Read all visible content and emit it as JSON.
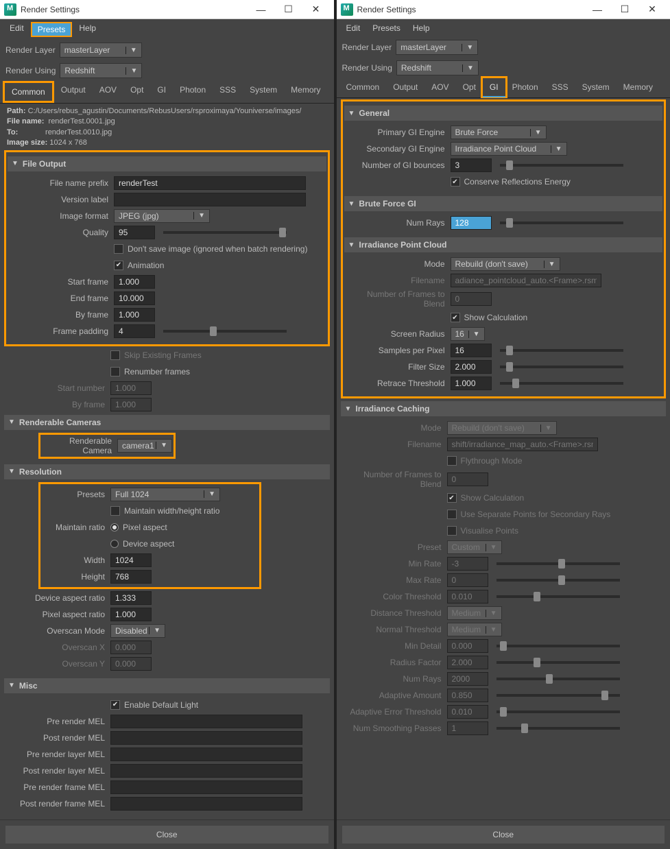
{
  "shared": {
    "window_title": "Render Settings",
    "menu": {
      "edit": "Edit",
      "presets": "Presets",
      "help": "Help"
    },
    "render_layer_lbl": "Render Layer",
    "render_layer_val": "masterLayer",
    "render_using_lbl": "Render Using",
    "render_using_val": "Redshift",
    "tabs": [
      "Common",
      "Output",
      "AOV",
      "Opt",
      "GI",
      "Photon",
      "SSS",
      "System",
      "Memory"
    ],
    "close_btn": "Close"
  },
  "left": {
    "info": {
      "path_lbl": "Path:",
      "path": "C:/Users/rebus_agustin/Documents/RebusUsers/rsproximaya/Youniverse/images/",
      "filename_lbl": "File name:",
      "filename": "renderTest.0001.jpg",
      "to_lbl": "To:",
      "to": "renderTest.0010.jpg",
      "imgsize_lbl": "Image size:",
      "imgsize": "1024 x 768"
    },
    "fileoutput": {
      "title": "File Output",
      "prefix_lbl": "File name prefix",
      "prefix": "renderTest",
      "version_lbl": "Version label",
      "version": "",
      "fmt_lbl": "Image format",
      "fmt": "JPEG (jpg)",
      "quality_lbl": "Quality",
      "quality": "95",
      "dontsave_lbl": "Don't save image (ignored when batch rendering)",
      "anim_lbl": "Animation",
      "start_lbl": "Start frame",
      "start": "1.000",
      "end_lbl": "End frame",
      "end": "10.000",
      "by_lbl": "By frame",
      "by": "1.000",
      "pad_lbl": "Frame padding",
      "pad": "4",
      "skip_lbl": "Skip Existing Frames",
      "renum_lbl": "Renumber frames",
      "startnum_lbl": "Start number",
      "startnum": "1.000",
      "byframe2_lbl": "By frame",
      "byframe2": "1.000"
    },
    "cameras": {
      "title": "Renderable Cameras",
      "cam_lbl": "Renderable Camera",
      "cam": "camera1"
    },
    "resolution": {
      "title": "Resolution",
      "presets_lbl": "Presets",
      "presets": "Full 1024",
      "maintain_lbl": "Maintain width/height ratio",
      "ratio_lbl": "Maintain ratio",
      "pixel_aspect": "Pixel aspect",
      "device_aspect": "Device aspect",
      "w_lbl": "Width",
      "w": "1024",
      "h_lbl": "Height",
      "h": "768",
      "dar_lbl": "Device aspect ratio",
      "dar": "1.333",
      "par_lbl": "Pixel aspect ratio",
      "par": "1.000",
      "om_lbl": "Overscan Mode",
      "om": "Disabled",
      "ox_lbl": "Overscan X",
      "ox": "0.000",
      "oy_lbl": "Overscan Y",
      "oy": "0.000"
    },
    "misc": {
      "title": "Misc",
      "edl_lbl": "Enable Default Light",
      "pre_mel": "Pre render MEL",
      "post_mel": "Post render MEL",
      "pre_layer": "Pre render layer MEL",
      "post_layer": "Post render layer MEL",
      "pre_frame": "Pre render frame MEL",
      "post_frame": "Post render frame MEL"
    }
  },
  "right": {
    "general": {
      "title": "General",
      "pgi_lbl": "Primary GI Engine",
      "pgi": "Brute Force",
      "sgi_lbl": "Secondary GI Engine",
      "sgi": "Irradiance Point Cloud",
      "nb_lbl": "Number of GI bounces",
      "nb": "3",
      "cre_lbl": "Conserve Reflections Energy"
    },
    "bf": {
      "title": "Brute Force GI",
      "nr_lbl": "Num Rays",
      "nr": "128"
    },
    "ipc": {
      "title": "Irradiance Point Cloud",
      "mode_lbl": "Mode",
      "mode": "Rebuild (don't save)",
      "fn_lbl": "Filename",
      "fn": "adiance_pointcloud_auto.<Frame>.rsmap",
      "nfb_lbl": "Number of Frames to Blend",
      "nfb": "0",
      "sc_lbl": "Show Calculation",
      "sr_lbl": "Screen Radius",
      "sr": "16",
      "spp_lbl": "Samples per Pixel",
      "spp": "16",
      "fs_lbl": "Filter Size",
      "fs": "2.000",
      "rt_lbl": "Retrace Threshold",
      "rt": "1.000"
    },
    "ic": {
      "title": "Irradiance Caching",
      "mode_lbl": "Mode",
      "mode": "Rebuild (don't save)",
      "fn_lbl": "Filename",
      "fn": "shift/irradiance_map_auto.<Frame>.rsmap",
      "ft_lbl": "Flythrough Mode",
      "nfb_lbl": "Number of Frames to Blend",
      "nfb": "0",
      "sc_lbl": "Show Calculation",
      "usp_lbl": "Use Separate Points for Secondary Rays",
      "vp_lbl": "Visualise Points",
      "preset_lbl": "Preset",
      "preset": "Custom",
      "minr_lbl": "Min Rate",
      "minr": "-3",
      "maxr_lbl": "Max Rate",
      "maxr": "0",
      "ct_lbl": "Color Threshold",
      "ct": "0.010",
      "dt_lbl": "Distance Threshold",
      "dt": "Medium",
      "nt_lbl": "Normal Threshold",
      "nt": "Medium",
      "md_lbl": "Min Detail",
      "md": "0.000",
      "rf_lbl": "Radius Factor",
      "rf": "2.000",
      "nr_lbl": "Num Rays",
      "nr": "2000",
      "aa_lbl": "Adaptive Amount",
      "aa": "0.850",
      "aet_lbl": "Adaptive Error Threshold",
      "aet": "0.010",
      "nsp_lbl": "Num Smoothing Passes",
      "nsp": "1"
    }
  }
}
